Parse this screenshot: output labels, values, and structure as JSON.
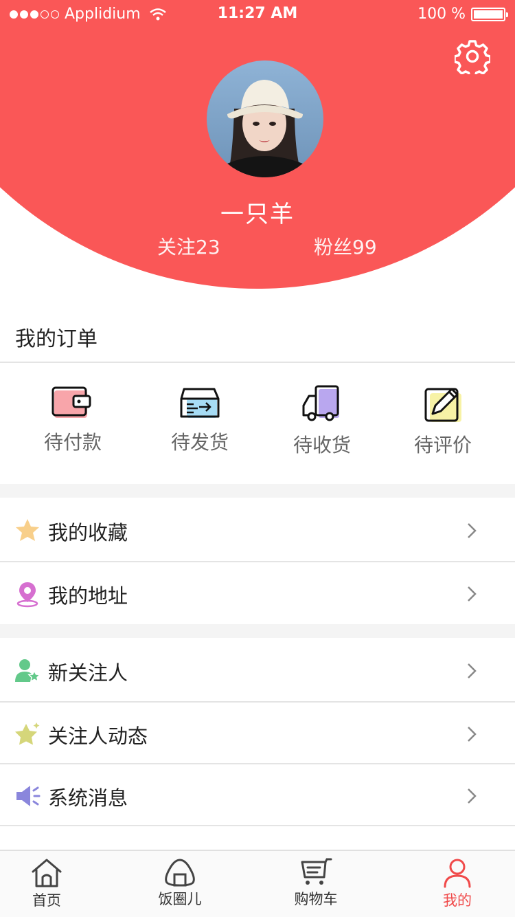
{
  "status_bar": {
    "carrier": "Applidium",
    "time": "11:27 AM",
    "battery": "100 %"
  },
  "profile": {
    "username": "一只羊",
    "following": "关注23",
    "fans": "粉丝99"
  },
  "colors": {
    "brand": "#fa5757",
    "active_tab": "#f04a4a",
    "band": "#f4f4f4"
  },
  "orders": {
    "title": "我的订单",
    "items": [
      {
        "label": "待付款",
        "icon": "wallet-icon"
      },
      {
        "label": "待发货",
        "icon": "package-icon"
      },
      {
        "label": "待收货",
        "icon": "truck-icon"
      },
      {
        "label": "待评价",
        "icon": "edit-icon"
      }
    ]
  },
  "menu": {
    "items": [
      {
        "label": "我的收藏",
        "icon": "star-icon"
      },
      {
        "label": "我的地址",
        "icon": "location-pin-icon"
      },
      {
        "label": "新关注人",
        "icon": "user-star-icon"
      },
      {
        "label": "关注人动态",
        "icon": "sparkle-star-icon"
      },
      {
        "label": "系统消息",
        "icon": "speaker-icon"
      }
    ]
  },
  "tabbar": {
    "items": [
      {
        "label": "首页",
        "icon": "home-icon"
      },
      {
        "label": "饭圈儿",
        "icon": "rice-ball-icon"
      },
      {
        "label": "购物车",
        "icon": "cart-icon"
      },
      {
        "label": "我的",
        "icon": "user-icon"
      }
    ],
    "active": "我的"
  }
}
